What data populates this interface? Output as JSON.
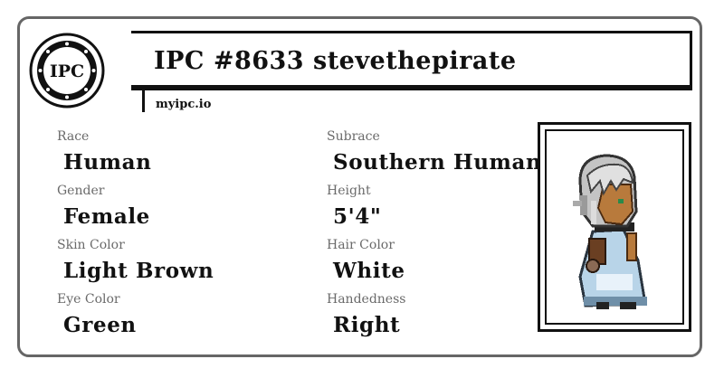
{
  "seal": {
    "text": "IPC"
  },
  "header": {
    "title": "IPC #8633 stevethepirate",
    "site": "myipc.io"
  },
  "fields": [
    {
      "label": "Race",
      "value": "Human"
    },
    {
      "label": "Subrace",
      "value": "Southern Human"
    },
    {
      "label": "Gender",
      "value": "Female"
    },
    {
      "label": "Height",
      "value": "5'4\""
    },
    {
      "label": "Skin Color",
      "value": "Light Brown"
    },
    {
      "label": "Hair Color",
      "value": "White"
    },
    {
      "label": "Eye Color",
      "value": "Green"
    },
    {
      "label": "Handedness",
      "value": "Right"
    }
  ],
  "colors": {
    "border": "#666666",
    "ink": "#111111",
    "label": "#6a6a6a"
  },
  "portrait": {
    "icon": "character-sprite"
  }
}
